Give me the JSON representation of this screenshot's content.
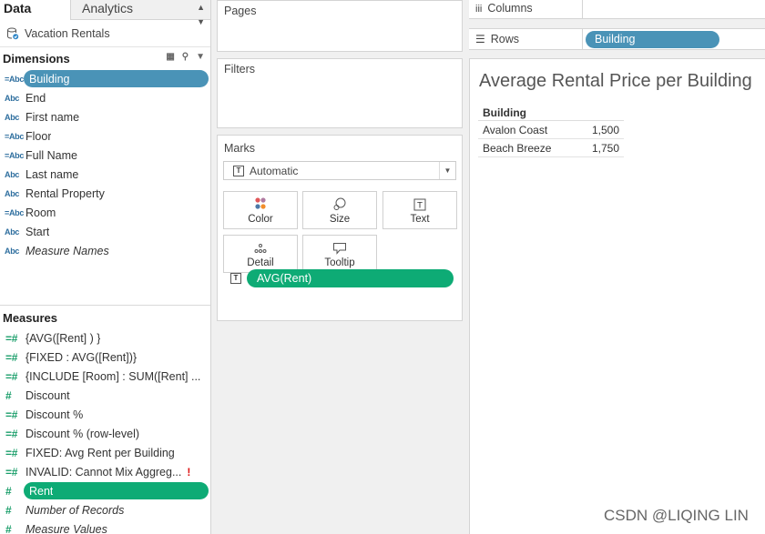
{
  "tabs": {
    "data": "Data",
    "analytics": "Analytics"
  },
  "datasource": {
    "name": "Vacation Rentals"
  },
  "dimensions": {
    "heading": "Dimensions",
    "items": [
      {
        "type": "=Abc",
        "label": "Building",
        "selected": true
      },
      {
        "type": "Abc",
        "label": "End"
      },
      {
        "type": "Abc",
        "label": "First name"
      },
      {
        "type": "=Abc",
        "label": "Floor"
      },
      {
        "type": "=Abc",
        "label": "Full Name"
      },
      {
        "type": "Abc",
        "label": "Last name"
      },
      {
        "type": "Abc",
        "label": "Rental Property"
      },
      {
        "type": "=Abc",
        "label": "Room"
      },
      {
        "type": "Abc",
        "label": "Start"
      },
      {
        "type": "Abc",
        "label": "Measure Names",
        "italic": true
      }
    ]
  },
  "measures": {
    "heading": "Measures",
    "items": [
      {
        "type": "=#",
        "label": "{AVG([Rent] ) }"
      },
      {
        "type": "=#",
        "label": "{FIXED : AVG([Rent])}"
      },
      {
        "type": "=#",
        "label": "{INCLUDE [Room] : SUM([Rent] ..."
      },
      {
        "type": "#",
        "label": "Discount"
      },
      {
        "type": "=#",
        "label": "Discount %"
      },
      {
        "type": "=#",
        "label": "Discount % (row-level)"
      },
      {
        "type": "=#",
        "label": "FIXED: Avg Rent per Building"
      },
      {
        "type": "=#",
        "label": "INVALID: Cannot Mix Aggreg...",
        "warning": "!"
      },
      {
        "type": "#",
        "label": "Rent",
        "selected": true
      },
      {
        "type": "#",
        "label": "Number of Records",
        "italic": true
      },
      {
        "type": "#",
        "label": "Measure Values",
        "italic": true
      }
    ]
  },
  "cards": {
    "pages": "Pages",
    "filters": "Filters",
    "marks": {
      "title": "Marks",
      "type": "Automatic",
      "buttons": [
        {
          "id": "color",
          "label": "Color"
        },
        {
          "id": "size",
          "label": "Size"
        },
        {
          "id": "text",
          "label": "Text"
        },
        {
          "id": "detail",
          "label": "Detail"
        },
        {
          "id": "tooltip",
          "label": "Tooltip"
        }
      ],
      "encoding": "AVG(Rent)",
      "encoding_icon": "T"
    }
  },
  "shelves": {
    "columns": {
      "label": "Columns",
      "pill": ""
    },
    "rows": {
      "label": "Rows",
      "pill": "Building"
    }
  },
  "view": {
    "title": "Average Rental Price per Building",
    "header": "Building",
    "rows": [
      {
        "building": "Avalon Coast",
        "value": "1,500"
      },
      {
        "building": "Beach Breeze",
        "value": "1,750"
      }
    ]
  },
  "watermark": "CSDN @LIQING LIN",
  "colors": {
    "blue_pill": "#4a93b7",
    "green_pill": "#0eab75",
    "dimension_icon": "#2f6f9f",
    "measure_icon": "#1a9e6a"
  }
}
